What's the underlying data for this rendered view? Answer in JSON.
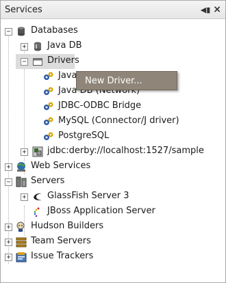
{
  "panel": {
    "title": "Services",
    "ctrl_glyph": "◀▮",
    "close_glyph": "×"
  },
  "tree": {
    "databases": "Databases",
    "java_db": "Java DB",
    "drivers": "Drivers",
    "driver_java_db_embedded": "Java DB (Embedded)",
    "driver_java_db_network": "Java DB (Network)",
    "driver_jdbc_odbc": "JDBC-ODBC Bridge",
    "driver_mysql": "MySQL (Connector/J driver)",
    "driver_postgresql": "PostgreSQL",
    "connection": "jdbc:derby://localhost:1527/sample",
    "web_services": "Web Services",
    "servers": "Servers",
    "glassfish": "GlassFish Server 3",
    "jboss": "JBoss Application Server",
    "hudson": "Hudson Builders",
    "team_servers": "Team Servers",
    "issue_trackers": "Issue Trackers"
  },
  "context_menu": {
    "new_driver": "New Driver..."
  },
  "toggle_expanded": "−",
  "toggle_collapsed": "+"
}
